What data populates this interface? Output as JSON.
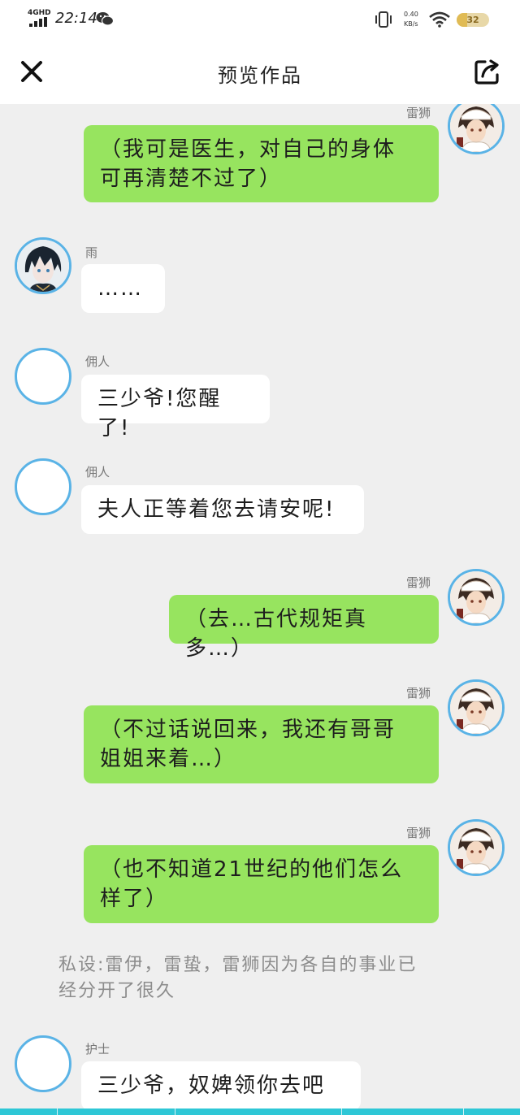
{
  "status_bar": {
    "network": "4GHD",
    "time": "22:14",
    "net_speed_value": "0.40",
    "net_speed_unit": "KB/s",
    "battery_text": "32",
    "battery_level": 0.32
  },
  "header": {
    "title": "预览作品",
    "close_icon": "close-icon",
    "share_icon": "share-icon"
  },
  "messages": [
    {
      "sender": "雷狮",
      "side": "right",
      "text_lines": [
        "（我可是医生，对自己的身体",
        "可再清楚不过了）"
      ]
    },
    {
      "sender": "雨",
      "side": "left",
      "text_lines": [
        "……"
      ]
    },
    {
      "sender": "佣人",
      "side": "left",
      "text_lines": [
        "三少爷!您醒了!"
      ]
    },
    {
      "sender": "佣人",
      "side": "left",
      "text_lines": [
        "夫人正等着您去请安呢!"
      ]
    },
    {
      "sender": "雷狮",
      "side": "right",
      "text_lines": [
        "（去…古代规矩真多…）"
      ]
    },
    {
      "sender": "雷狮",
      "side": "right",
      "text_lines": [
        "（不过话说回来，我还有哥哥",
        "姐姐来着…）"
      ]
    },
    {
      "sender": "雷狮",
      "side": "right",
      "text_lines": [
        "（也不知道21世纪的他们怎么",
        "样了）"
      ]
    },
    {
      "narration_lines": [
        "私设:雷伊，雷蛰，雷狮因为各自的事业已",
        "经分开了很久"
      ]
    },
    {
      "sender": "护士",
      "side": "left",
      "text_lines": [
        "三少爷，奴婢领你去吧"
      ]
    }
  ],
  "colors": {
    "bubble_green": "#97e45f",
    "bubble_white": "#ffffff",
    "avatar_ring": "#5ab3e6",
    "chat_background": "#efefef",
    "bottom_strip": "#2ec7d6"
  }
}
